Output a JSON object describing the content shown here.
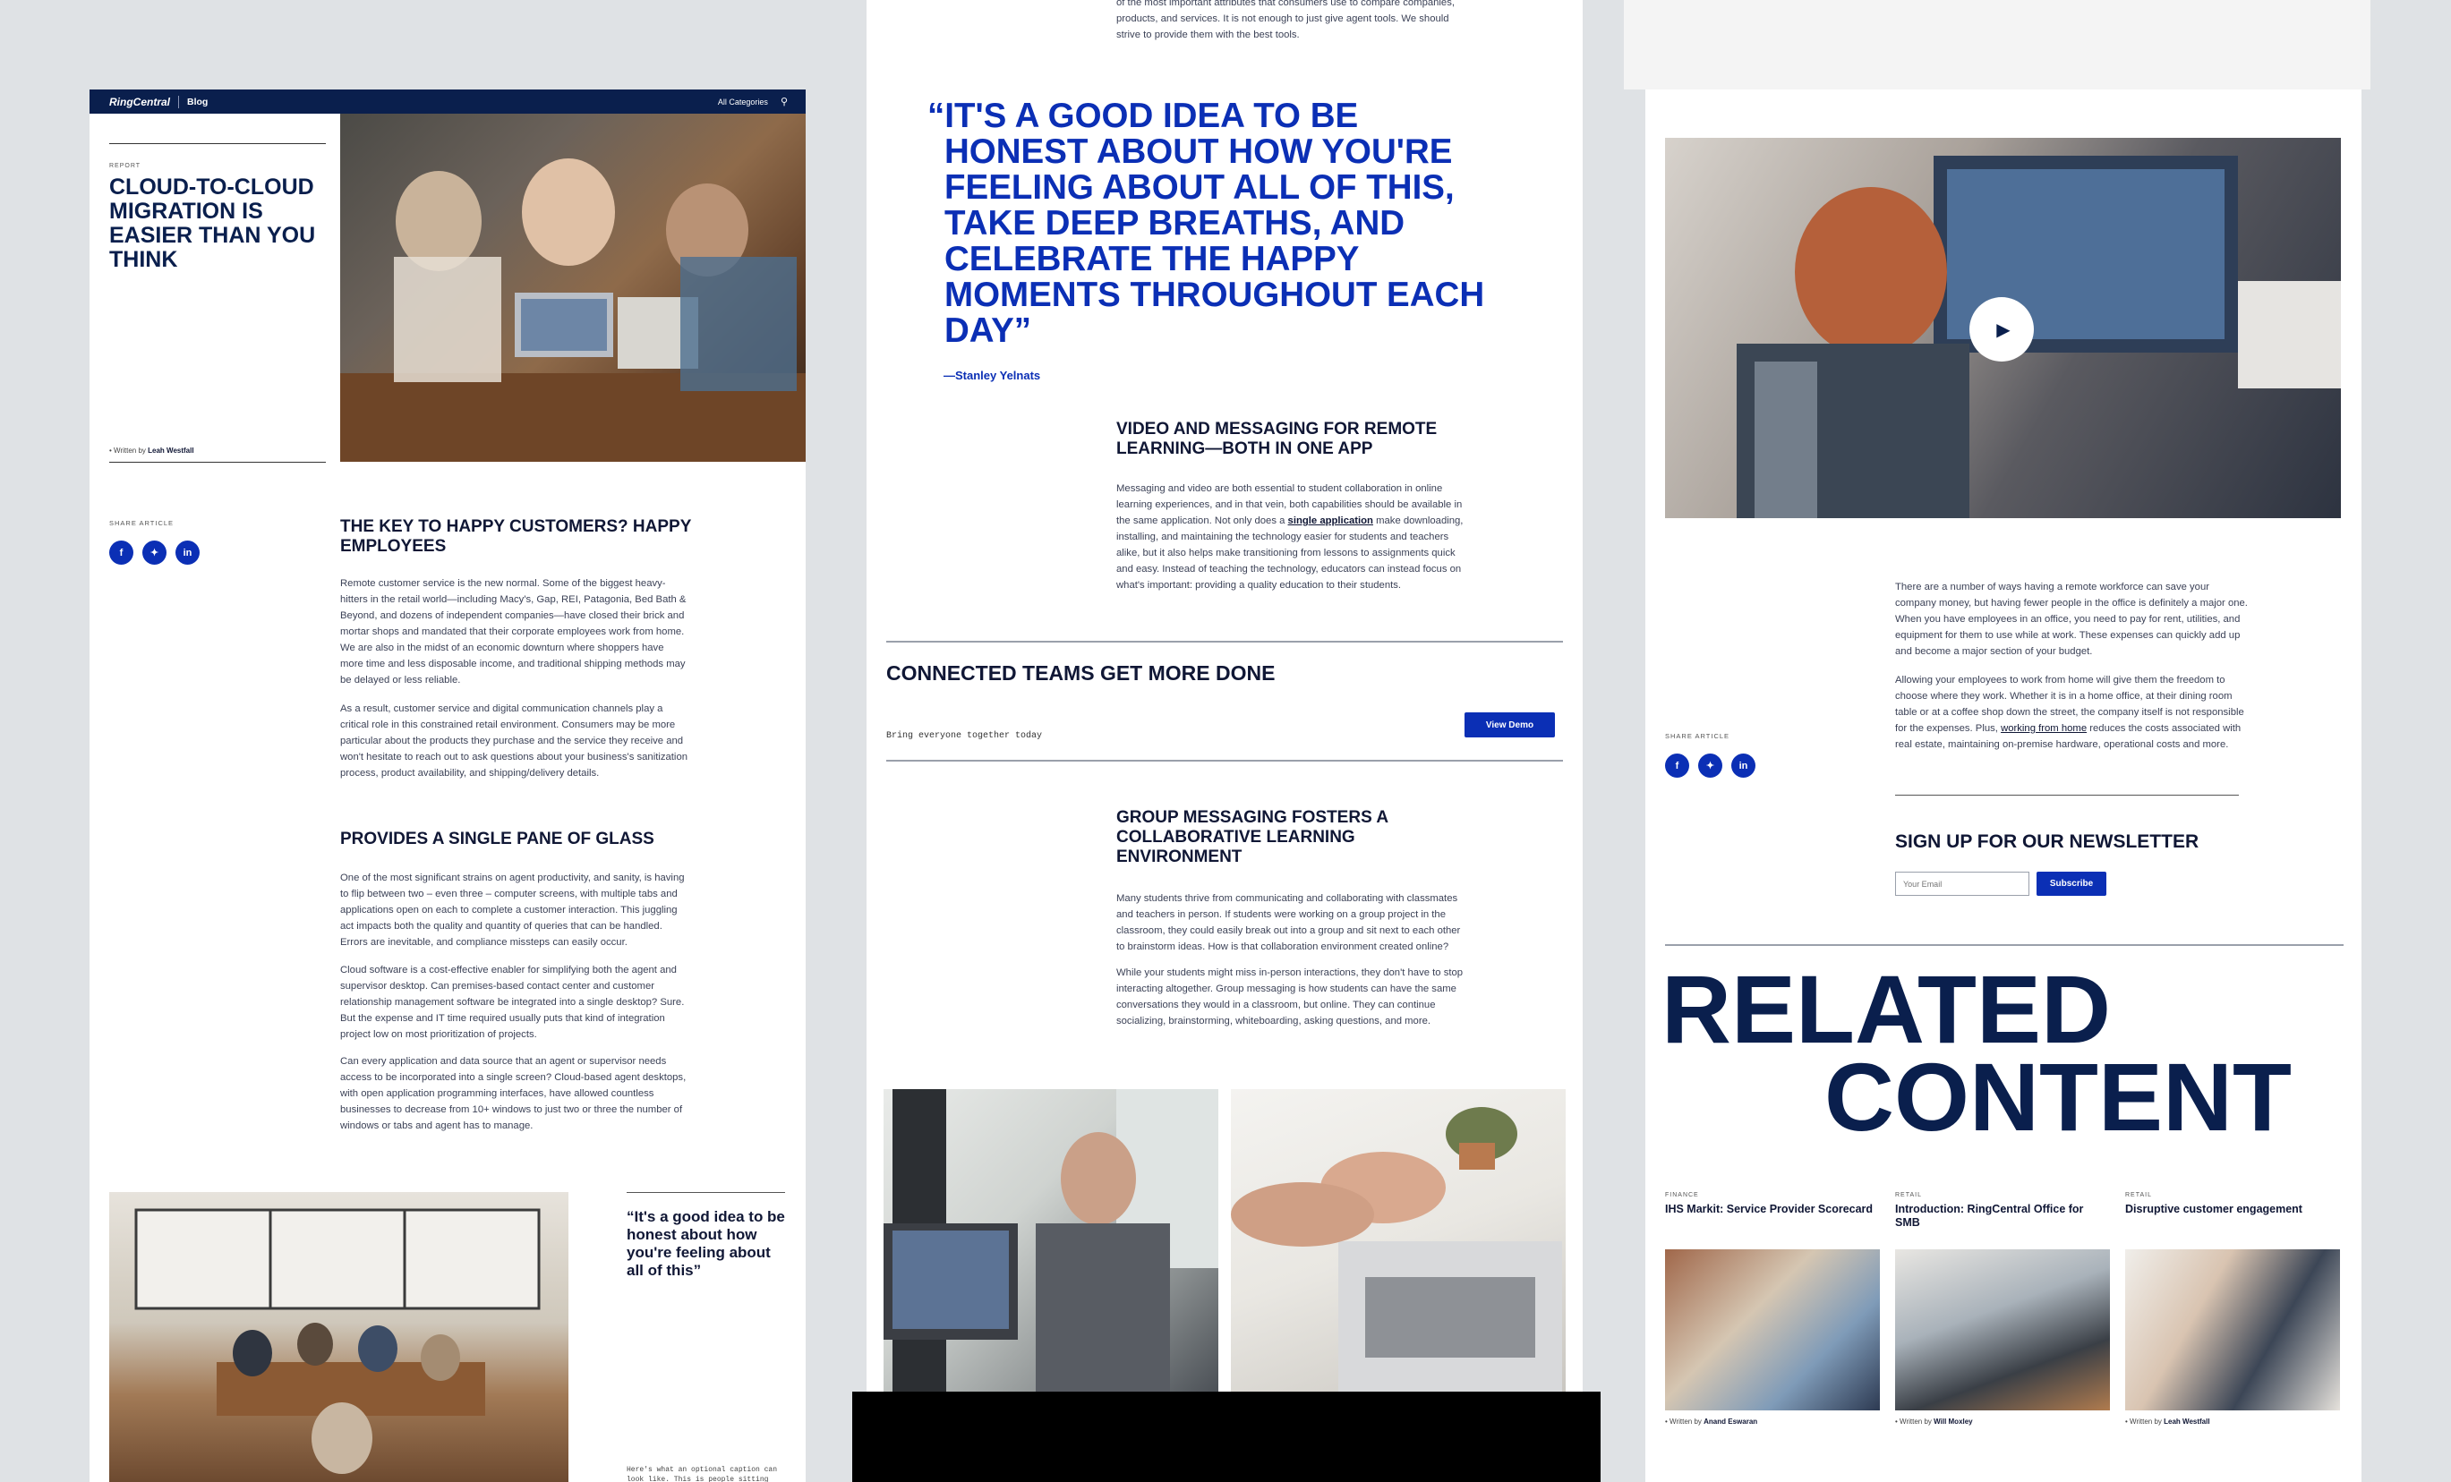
{
  "left": {
    "nav": {
      "brand": "RingCentral",
      "section": "Blog",
      "categories": "All Categories",
      "search_icon": "search-icon"
    },
    "hero": {
      "eyebrow": "REPORT",
      "title": "CLOUD-TO-CLOUD MIGRATION IS EASIER THAN YOU THINK",
      "byline_prefix": "Written by",
      "author": "Leah Westfall"
    },
    "share_label": "SHARE ARTICLE",
    "section1": {
      "heading": "THE KEY TO HAPPY CUSTOMERS? HAPPY EMPLOYEES",
      "p1": "Remote customer service is the new normal. Some of the biggest heavy-hitters in the retail world—including Macy's, Gap, REI, Patagonia, Bed Bath & Beyond, and dozens of independent companies—have closed their brick and mortar shops and mandated that their corporate employees work from home. We are also in the midst of an economic downturn where shoppers have more time and less disposable income, and traditional shipping methods may be delayed or less reliable.",
      "p2": "As a result, customer service and digital communication channels play a critical role in this constrained retail environment. Consumers may be more particular about the products they purchase and the service they receive and won't hesitate to reach out to ask questions about your business's sanitization process, product availability, and shipping/delivery details."
    },
    "section2": {
      "heading": "PROVIDES A SINGLE PANE OF GLASS",
      "p1": "One of the most significant strains on agent productivity, and sanity, is having to flip between two – even three – computer screens, with multiple tabs and applications open on each to complete a customer interaction. This juggling act impacts both the quality and quantity of queries that can be handled. Errors are inevitable, and compliance missteps can easily occur.",
      "p2": "Cloud software is a cost-effective enabler for simplifying both the agent and supervisor desktop. Can premises-based contact center and customer relationship management software be integrated into a single desktop? Sure. But the expense and IT time required usually puts that kind of integration project low on most prioritization of projects.",
      "p3": "Can every application and data source that an agent or supervisor needs access to be incorporated into a single screen? Cloud-based agent desktops, with open application programming interfaces, have allowed countless businesses to decrease from 10+ windows to just two or three the number of windows or tabs and agent has to manage."
    },
    "pullquote": "“It's a good idea to be honest about how you're feeling about all of this”",
    "caption": "Here's what an optional caption can look like. This is people sitting"
  },
  "middle": {
    "intro_tail": "of the most important attributes that consumers use to compare companies, products, and services. It is not enough to just give agent tools. We should strive to provide them with the best tools.",
    "quote": "“IT'S A GOOD IDEA TO BE HONEST ABOUT HOW YOU'RE FEELING ABOUT ALL OF THIS, TAKE DEEP BREATHS, AND CELEBRATE THE HAPPY MOMENTS THROUGHOUT EACH DAY”",
    "quote_author": "—Stanley Yelnats",
    "section1": {
      "heading": "VIDEO AND MESSAGING FOR REMOTE LEARNING—BOTH IN ONE APP",
      "p1_a": "Messaging and video are both essential to student collaboration in online learning experiences, and in that vein, both capabilities should be available in the same application. Not only does a ",
      "p1_link": "single application",
      "p1_b": " make downloading, installing, and maintaining the technology easier for students and teachers alike, but it also helps make transitioning from lessons to assignments quick and easy. Instead of teaching the technology, educators can instead focus on what's important: providing a quality education to their students."
    },
    "cta": {
      "heading": "CONNECTED TEAMS GET MORE DONE",
      "sub": "Bring everyone together today",
      "button": "View Demo"
    },
    "section2": {
      "heading": "GROUP MESSAGING FOSTERS A COLLABORATIVE LEARNING ENVIRONMENT",
      "p1": "Many students thrive from communicating and collaborating with classmates and teachers in person. If students were working on a group project in the classroom, they could easily break out into a group and sit next to each other to brainstorm ideas. How is that collaboration environment created online?",
      "p2": "While your students might miss in-person interactions, they don't have to stop interacting altogether. Group messaging is how students can have the same conversations they would in a classroom, but online. They can continue socializing, brainstorming, whiteboarding, asking questions, and more."
    }
  },
  "right": {
    "share_label": "SHARE ARTICLE",
    "p1": "There are a number of ways having a remote workforce can save your company money, but having fewer people in the office is definitely a major one. When you have employees in an office, you need to pay for rent, utilities, and equipment for them to use while at work. These expenses can quickly add up and become a major section of your budget.",
    "p2_a": "Allowing your employees to work from home will give them the freedom to choose where they work. Whether it is in a home office, at their dining room table or at a coffee shop down the street, the company itself is not responsible for the expenses. Plus, ",
    "p2_link": "working from home",
    "p2_b": " reduces the costs associated with real estate, maintaining on-premise hardware, operational costs and more.",
    "newsletter": {
      "heading": "SIGN UP FOR OUR NEWSLETTER",
      "placeholder": "Your Email",
      "button": "Subscribe"
    },
    "related": {
      "line1": "RELATED",
      "line2": "CONTENT",
      "items": [
        {
          "tag": "FINANCE",
          "title": "IHS Markit: Service Provider Scorecard",
          "by": "Written by",
          "author": "Anand Eswaran"
        },
        {
          "tag": "RETAIL",
          "title": "Introduction: RingCentral Office for SMB",
          "by": "Written by",
          "author": "Will Moxley"
        },
        {
          "tag": "RETAIL",
          "title": "Disruptive customer engagement",
          "by": "Written by",
          "author": "Leah Westfall"
        }
      ]
    }
  }
}
